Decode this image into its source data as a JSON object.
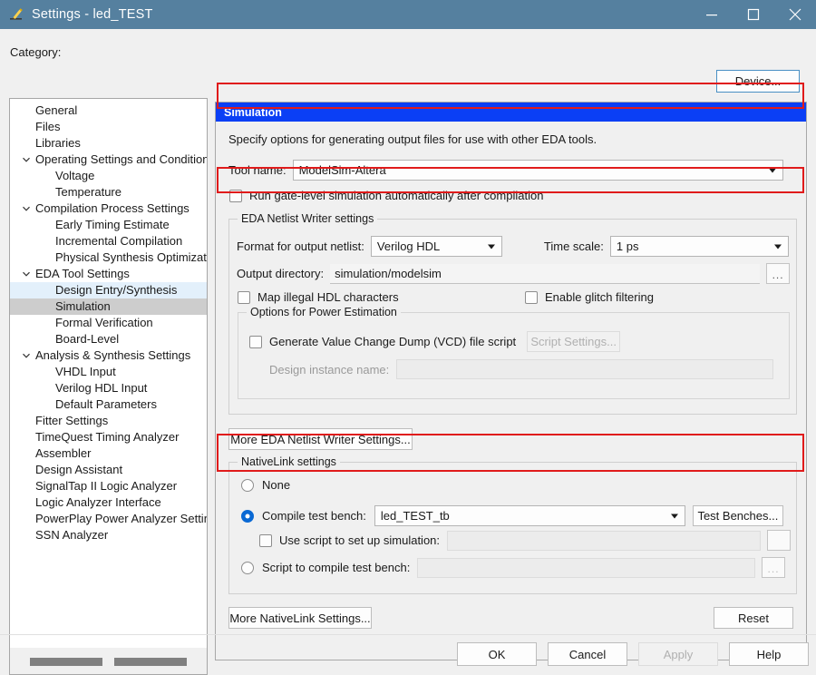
{
  "window": {
    "title": "Settings - led_TEST",
    "icon": "pencil-icon",
    "controls": {
      "minimize": "minimize-icon",
      "maximize": "maximize-icon",
      "close": "close-icon"
    }
  },
  "toolbar": {
    "category_label": "Category:",
    "device_button": "Device..."
  },
  "sidebar": {
    "items": [
      {
        "label": "General",
        "level": 0,
        "expander": false,
        "state": "normal"
      },
      {
        "label": "Files",
        "level": 0,
        "expander": false,
        "state": "normal"
      },
      {
        "label": "Libraries",
        "level": 0,
        "expander": false,
        "state": "normal"
      },
      {
        "label": "Operating Settings and Conditions",
        "level": 0,
        "expander": true,
        "state": "normal"
      },
      {
        "label": "Voltage",
        "level": 1,
        "expander": false,
        "state": "normal"
      },
      {
        "label": "Temperature",
        "level": 1,
        "expander": false,
        "state": "normal"
      },
      {
        "label": "Compilation Process Settings",
        "level": 0,
        "expander": true,
        "state": "normal"
      },
      {
        "label": "Early Timing Estimate",
        "level": 1,
        "expander": false,
        "state": "normal"
      },
      {
        "label": "Incremental Compilation",
        "level": 1,
        "expander": false,
        "state": "normal"
      },
      {
        "label": "Physical Synthesis Optimization",
        "level": 1,
        "expander": false,
        "state": "normal"
      },
      {
        "label": "EDA Tool Settings",
        "level": 0,
        "expander": true,
        "state": "normal"
      },
      {
        "label": "Design Entry/Synthesis",
        "level": 1,
        "expander": false,
        "state": "hover"
      },
      {
        "label": "Simulation",
        "level": 1,
        "expander": false,
        "state": "selected"
      },
      {
        "label": "Formal Verification",
        "level": 1,
        "expander": false,
        "state": "normal"
      },
      {
        "label": "Board-Level",
        "level": 1,
        "expander": false,
        "state": "normal"
      },
      {
        "label": "Analysis & Synthesis Settings",
        "level": 0,
        "expander": true,
        "state": "normal"
      },
      {
        "label": "VHDL Input",
        "level": 1,
        "expander": false,
        "state": "normal"
      },
      {
        "label": "Verilog HDL Input",
        "level": 1,
        "expander": false,
        "state": "normal"
      },
      {
        "label": "Default Parameters",
        "level": 1,
        "expander": false,
        "state": "normal"
      },
      {
        "label": "Fitter Settings",
        "level": 0,
        "expander": false,
        "state": "normal"
      },
      {
        "label": "TimeQuest Timing Analyzer",
        "level": 0,
        "expander": false,
        "state": "normal"
      },
      {
        "label": "Assembler",
        "level": 0,
        "expander": false,
        "state": "normal"
      },
      {
        "label": "Design Assistant",
        "level": 0,
        "expander": false,
        "state": "normal"
      },
      {
        "label": "SignalTap II Logic Analyzer",
        "level": 0,
        "expander": false,
        "state": "normal"
      },
      {
        "label": "Logic Analyzer Interface",
        "level": 0,
        "expander": false,
        "state": "normal"
      },
      {
        "label": "PowerPlay Power Analyzer Settings",
        "level": 0,
        "expander": false,
        "state": "normal"
      },
      {
        "label": "SSN Analyzer",
        "level": 0,
        "expander": false,
        "state": "normal"
      }
    ]
  },
  "panel": {
    "header": "Simulation",
    "description": "Specify options for generating output files for use with other EDA tools.",
    "tool_name": {
      "label": "Tool name:",
      "value": "ModelSim-Altera"
    },
    "run_gate_level": {
      "label": "Run gate-level simulation automatically after compilation",
      "checked": false
    },
    "netlist_group": {
      "title": "EDA Netlist Writer settings",
      "format_label": "Format for output netlist:",
      "format_value": "Verilog HDL",
      "timescale_label": "Time scale:",
      "timescale_value": "1 ps",
      "output_dir_label": "Output directory:",
      "output_dir_value": "simulation/modelsim",
      "browse_label": "...",
      "map_illegal_label": "Map illegal HDL characters",
      "map_illegal_checked": false,
      "glitch_label": "Enable glitch filtering",
      "glitch_checked": false,
      "power_group": {
        "title": "Options for Power Estimation",
        "vcd_label": "Generate Value Change Dump (VCD) file script",
        "vcd_checked": false,
        "script_settings_button": "Script Settings...",
        "design_instance_label": "Design instance name:",
        "design_instance_value": ""
      }
    },
    "more_eda_button": "More EDA Netlist Writer Settings...",
    "nativelink_group": {
      "title": "NativeLink settings",
      "option_none": "None",
      "option_compile_tb": "Compile test bench:",
      "compile_tb_value": "led_TEST_tb",
      "test_benches_button": "Test Benches...",
      "use_script_label": "Use script to set up simulation:",
      "use_script_checked": false,
      "use_script_value": "",
      "option_script_compile": "Script to compile test bench:",
      "script_compile_value": "",
      "browse_label": "...",
      "selected_option": "compile_test_bench"
    },
    "more_nativelink_button": "More NativeLink Settings...",
    "reset_button": "Reset"
  },
  "footer": {
    "ok": "OK",
    "cancel": "Cancel",
    "apply": "Apply",
    "help": "Help",
    "apply_disabled": true
  },
  "colors": {
    "titlebar": "#55809f",
    "panel_header": "#0b3ff5",
    "highlight_red": "#e01b1b",
    "selection_grey": "#cdcdcd",
    "hover_blue": "#e3f0fb",
    "radio_blue": "#0a69d4",
    "device_border": "#4a90c4"
  }
}
